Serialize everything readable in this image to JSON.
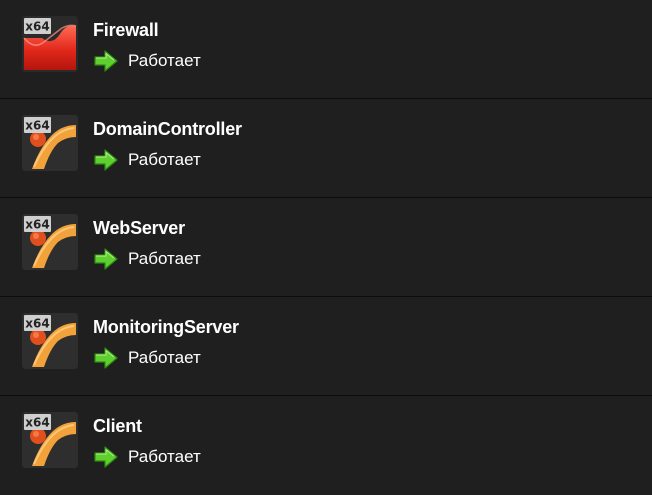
{
  "vm_list": {
    "items": [
      {
        "name": "Firewall",
        "status": "Работает",
        "os_icon": "firewall-x64-icon",
        "arch_badge": "x64",
        "status_icon": "running-arrow-icon",
        "icon_color": "#e03a2a"
      },
      {
        "name": "DomainController",
        "status": "Работает",
        "os_icon": "os-x64-icon",
        "arch_badge": "x64",
        "status_icon": "running-arrow-icon",
        "icon_color": "#f2a23a"
      },
      {
        "name": "WebServer",
        "status": "Работает",
        "os_icon": "os-x64-icon",
        "arch_badge": "x64",
        "status_icon": "running-arrow-icon",
        "icon_color": "#f2a23a"
      },
      {
        "name": "MonitoringServer",
        "status": "Работает",
        "os_icon": "os-x64-icon",
        "arch_badge": "x64",
        "status_icon": "running-arrow-icon",
        "icon_color": "#f2a23a"
      },
      {
        "name": "Client",
        "status": "Работает",
        "os_icon": "os-x64-icon",
        "arch_badge": "x64",
        "status_icon": "running-arrow-icon",
        "icon_color": "#f2a23a"
      }
    ]
  },
  "colors": {
    "background": "#1f1f1f",
    "separator": "#0d0d0d",
    "text": "#ffffff",
    "running_arrow": "#5fcf2f"
  }
}
